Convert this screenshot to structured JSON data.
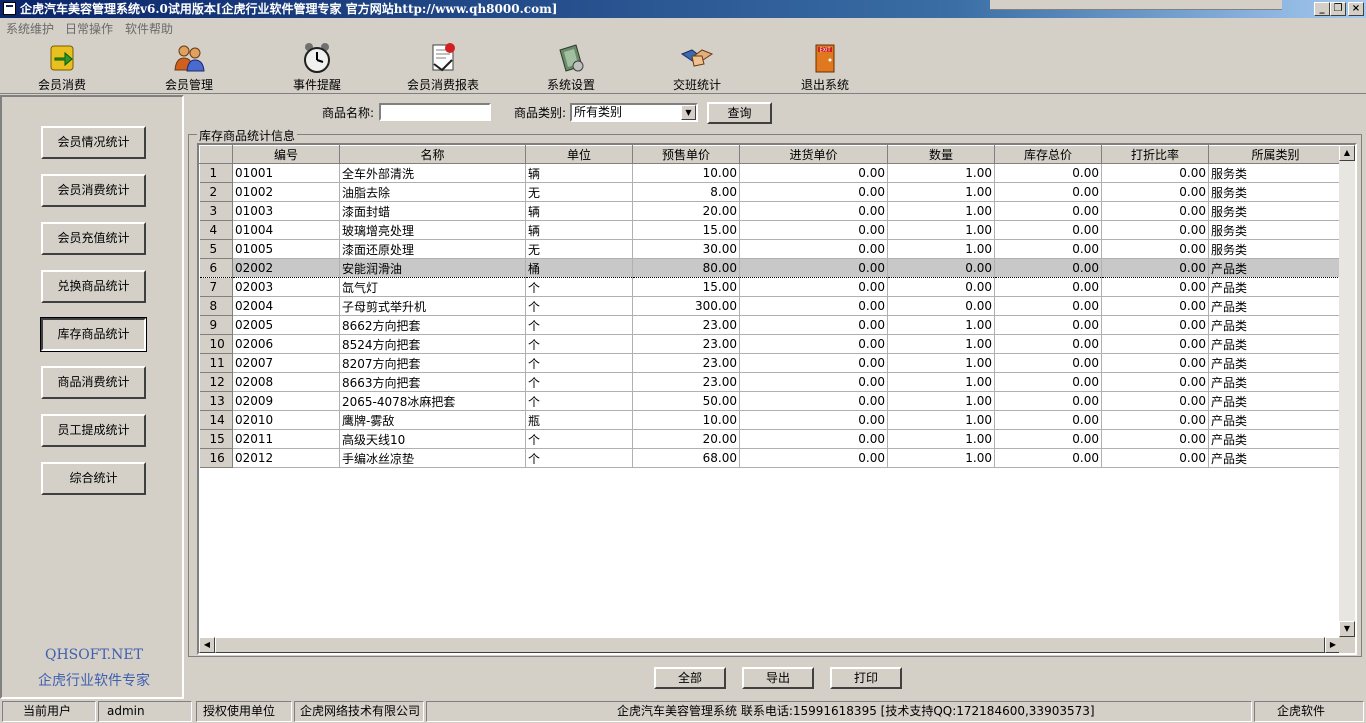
{
  "window": {
    "title": "企虎汽车美容管理系统v6.0试用版本[企虎行业软件管理专家 官方网站http://www.qh8000.com]",
    "minimize": "_",
    "restore": "❐",
    "close": "×"
  },
  "menu": [
    "系统维护",
    "日常操作",
    "软件帮助"
  ],
  "toolbar": [
    {
      "label": "会员消费",
      "icon": "coin-arrow-icon"
    },
    {
      "label": "会员管理",
      "icon": "users-icon"
    },
    {
      "label": "事件提醒",
      "icon": "alarm-clock-icon"
    },
    {
      "label": "会员消费报表",
      "icon": "report-icon"
    },
    {
      "label": "系统设置",
      "icon": "settings-icon"
    },
    {
      "label": "交班统计",
      "icon": "handshake-icon"
    },
    {
      "label": "退出系统",
      "icon": "exit-door-icon"
    }
  ],
  "nav": [
    {
      "label": "会员情况统计",
      "active": false
    },
    {
      "label": "会员消费统计",
      "active": false
    },
    {
      "label": "会员充值统计",
      "active": false
    },
    {
      "label": "兑换商品统计",
      "active": false
    },
    {
      "label": "库存商品统计",
      "active": true
    },
    {
      "label": "商品消费统计",
      "active": false
    },
    {
      "label": "员工提成统计",
      "active": false
    },
    {
      "label": "综合统计",
      "active": false
    }
  ],
  "brand": {
    "line1": "QHSOFT.NET",
    "line2": "企虎行业软件专家",
    "color": "#3f5fb0"
  },
  "search": {
    "name_label": "商品名称:",
    "name_value": "",
    "category_label": "商品类别:",
    "category_value": "所有类别",
    "query_button": "查询"
  },
  "group_title": "库存商品统计信息",
  "table": {
    "columns": [
      "编号",
      "名称",
      "单位",
      "预售单价",
      "进货单价",
      "数量",
      "库存总价",
      "打折比率",
      "所属类别"
    ],
    "rows": [
      [
        "1",
        "01001",
        "全车外部清洗",
        "辆",
        "10.00",
        "0.00",
        "1.00",
        "0.00",
        "0.00",
        "服务类"
      ],
      [
        "2",
        "01002",
        "油脂去除",
        "无",
        "8.00",
        "0.00",
        "1.00",
        "0.00",
        "0.00",
        "服务类"
      ],
      [
        "3",
        "01003",
        "漆面封蜡",
        "辆",
        "20.00",
        "0.00",
        "1.00",
        "0.00",
        "0.00",
        "服务类"
      ],
      [
        "4",
        "01004",
        "玻璃增亮处理",
        "辆",
        "15.00",
        "0.00",
        "1.00",
        "0.00",
        "0.00",
        "服务类"
      ],
      [
        "5",
        "01005",
        "漆面还原处理",
        "无",
        "30.00",
        "0.00",
        "1.00",
        "0.00",
        "0.00",
        "服务类"
      ],
      [
        "6",
        "02002",
        "安能润滑油",
        "桶",
        "80.00",
        "0.00",
        "0.00",
        "0.00",
        "0.00",
        "产品类"
      ],
      [
        "7",
        "02003",
        "氙气灯",
        "个",
        "15.00",
        "0.00",
        "0.00",
        "0.00",
        "0.00",
        "产品类"
      ],
      [
        "8",
        "02004",
        "子母剪式举升机",
        "个",
        "300.00",
        "0.00",
        "0.00",
        "0.00",
        "0.00",
        "产品类"
      ],
      [
        "9",
        "02005",
        "8662方向把套",
        "个",
        "23.00",
        "0.00",
        "1.00",
        "0.00",
        "0.00",
        "产品类"
      ],
      [
        "10",
        "02006",
        "8524方向把套",
        "个",
        "23.00",
        "0.00",
        "1.00",
        "0.00",
        "0.00",
        "产品类"
      ],
      [
        "11",
        "02007",
        "8207方向把套",
        "个",
        "23.00",
        "0.00",
        "1.00",
        "0.00",
        "0.00",
        "产品类"
      ],
      [
        "12",
        "02008",
        "8663方向把套",
        "个",
        "23.00",
        "0.00",
        "1.00",
        "0.00",
        "0.00",
        "产品类"
      ],
      [
        "13",
        "02009",
        "2065-4078冰麻把套",
        "个",
        "50.00",
        "0.00",
        "1.00",
        "0.00",
        "0.00",
        "产品类"
      ],
      [
        "14",
        "02010",
        "鹰牌-雾敌",
        "瓶",
        "10.00",
        "0.00",
        "1.00",
        "0.00",
        "0.00",
        "产品类"
      ],
      [
        "15",
        "02011",
        "高级天线10",
        "个",
        "20.00",
        "0.00",
        "1.00",
        "0.00",
        "0.00",
        "产品类"
      ],
      [
        "16",
        "02012",
        "手编冰丝凉垫",
        "个",
        "68.00",
        "0.00",
        "1.00",
        "0.00",
        "0.00",
        "产品类"
      ]
    ],
    "selected_row": 6
  },
  "bottom_buttons": {
    "all": "全部",
    "export": "导出",
    "print": "打印"
  },
  "status": {
    "user_label": "当前用户",
    "user_value": "admin",
    "licensee_label": "授权使用单位",
    "licensee_value": "企虎网络技术有限公司",
    "contact": "企虎汽车美容管理系统 联系电话:15991618395 [技术支持QQ:172184600,33903573]",
    "brand": "企虎软件"
  }
}
